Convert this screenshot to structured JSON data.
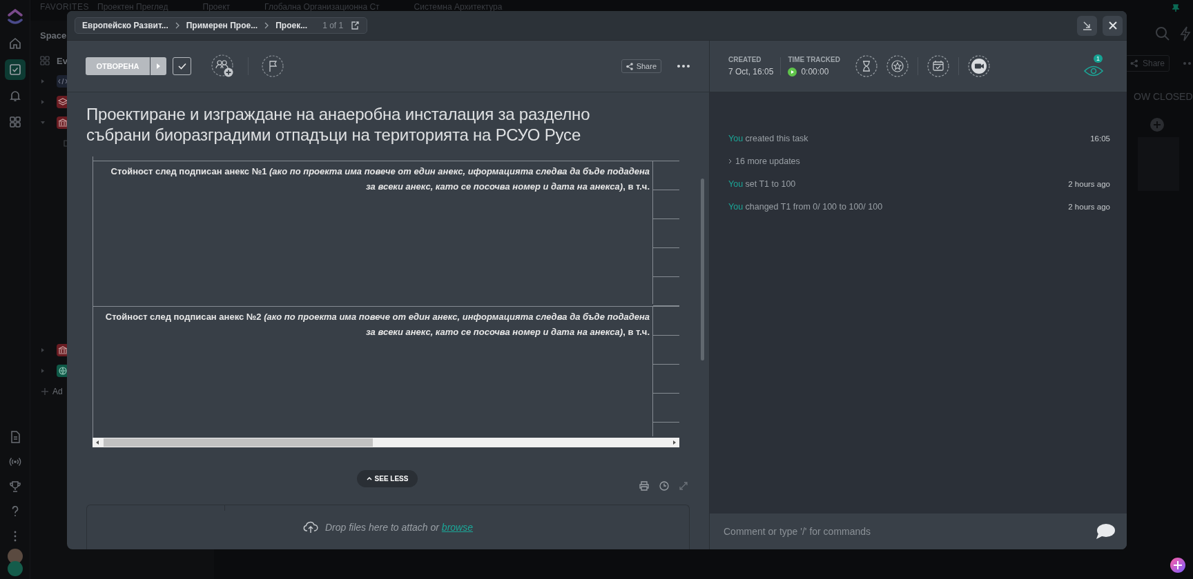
{
  "rail": {
    "items": [
      {
        "kind": "home",
        "selected": false
      },
      {
        "kind": "tasks",
        "selected": true
      },
      {
        "kind": "bell",
        "selected": false
      },
      {
        "kind": "dashboard",
        "selected": false
      }
    ],
    "bottom": [
      {
        "kind": "doc"
      },
      {
        "kind": "broadcast"
      },
      {
        "kind": "trophy"
      },
      {
        "kind": "help"
      },
      {
        "kind": "more"
      }
    ]
  },
  "favorites": {
    "label": "FAVORITES",
    "items": [
      "Проектен Преглед",
      "Проект",
      "Глобална Организационна Ст",
      "Системна Архитектура"
    ]
  },
  "sidebar": {
    "heading": "Space",
    "items": [
      {
        "kind": "view",
        "label": "Ev"
      },
      {
        "kind": "space",
        "color": "#1c2230",
        "expanded": false
      },
      {
        "kind": "space",
        "color": "#6a1c22",
        "expanded": false
      },
      {
        "kind": "space",
        "color": "#6a1c22",
        "expanded": true
      },
      {
        "kind": "folder"
      },
      {
        "kind": "gap"
      },
      {
        "kind": "space",
        "color": "#6a1c22",
        "expanded": false
      },
      {
        "kind": "space",
        "color": "#0f5a48",
        "expanded": false
      },
      {
        "kind": "add",
        "label": "Ad"
      }
    ]
  },
  "background": {
    "share": "Share",
    "column_heading": "OW CLOSED"
  },
  "task": {
    "breadcrumbs": [
      "Европейско Развит...",
      "Примерен Прое...",
      "Проек..."
    ],
    "position": "1 of 1",
    "status": "ОТВОРЕНА",
    "share": "Share",
    "title": "Проектиране и изграждане на анаеробна инсталация за разделно събрани биоразградими отпадъци на територията на РСУО Русе",
    "table_rows": [
      {
        "text": "Стойност след подписан анекс №1 *(ако по проекта има повече от един анекс, иформацията следва да бъде подадена за всеки анекс, като се посочва номер и дата на анекса)*, в т.ч."
      },
      {
        "text": "Стойност след подписан анекс №2 *(ако по проекта има повече от един анекс, информацията следва да бъде подадена за всеки анекс, като се посочва номер и дата на анекса)*, в т.ч."
      }
    ],
    "see_less": "SEE LESS",
    "attach": {
      "text": "Drop files here to attach or",
      "link": "browse"
    },
    "created_label": "CREATED",
    "created": "7 Oct, 16:05",
    "time_label": "TIME TRACKED",
    "time": "0:00:00",
    "watchers": "1",
    "activity": [
      {
        "kind": "event",
        "actor": "You",
        "text": "created this task",
        "time": "16:05"
      },
      {
        "kind": "more",
        "text": "16 more updates"
      },
      {
        "kind": "event",
        "actor": "You",
        "text": "set T1 to 100",
        "time": "2 hours ago"
      },
      {
        "kind": "event",
        "actor": "You",
        "text": "changed T1 from 0/ 100 to 100/ 100",
        "time": "2 hours ago"
      }
    ],
    "comment": {
      "placeholder": "Comment or type '/' for commands"
    }
  }
}
